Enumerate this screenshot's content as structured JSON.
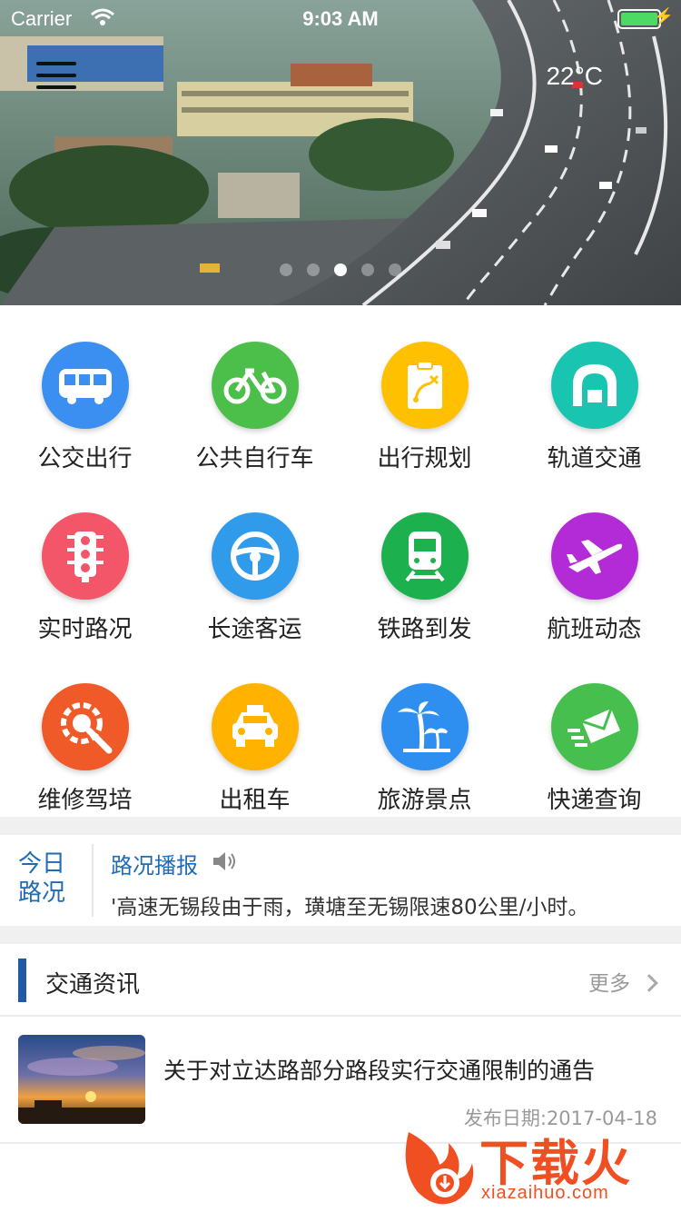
{
  "status_bar": {
    "carrier": "Carrier",
    "time": "9:03 AM"
  },
  "banner": {
    "weather": "22°C",
    "dot_count": 5,
    "active_dot": 2
  },
  "services": [
    {
      "label": "公交出行",
      "icon": "bus-icon",
      "color": "#3b8ff0"
    },
    {
      "label": "公共自行车",
      "icon": "bicycle-icon",
      "color": "#4cbf4a"
    },
    {
      "label": "出行规划",
      "icon": "route-plan-icon",
      "color": "#ffc000"
    },
    {
      "label": "轨道交通",
      "icon": "tunnel-icon",
      "color": "#19c4b0"
    },
    {
      "label": "实时路况",
      "icon": "traffic-light-icon",
      "color": "#f25668"
    },
    {
      "label": "长途客运",
      "icon": "steering-wheel-icon",
      "color": "#2f9bea"
    },
    {
      "label": "铁路到发",
      "icon": "train-icon",
      "color": "#1db04e"
    },
    {
      "label": "航班动态",
      "icon": "airplane-icon",
      "color": "#b32bd6"
    },
    {
      "label": "维修驾培",
      "icon": "repair-gear-icon",
      "color": "#f05a28"
    },
    {
      "label": "出租车",
      "icon": "taxi-icon",
      "color": "#ffb300"
    },
    {
      "label": "旅游景点",
      "icon": "palm-tree-icon",
      "color": "#2f8ff0"
    },
    {
      "label": "快递查询",
      "icon": "envelope-icon",
      "color": "#46bf4e"
    }
  ],
  "broadcast": {
    "today_label": "今日路况",
    "title": "路况播报",
    "text": "'高速无锡段由于雨，璜塘至无锡限速80公里/小时。"
  },
  "news": {
    "section_title": "交通资讯",
    "more_label": "更多",
    "items": [
      {
        "headline": "关于对立达路部分路段实行交通限制的通告",
        "date": "发布日期:2017-04-18"
      }
    ]
  },
  "watermark": {
    "brand": "下载火",
    "url": "xiazaihuo.com"
  }
}
